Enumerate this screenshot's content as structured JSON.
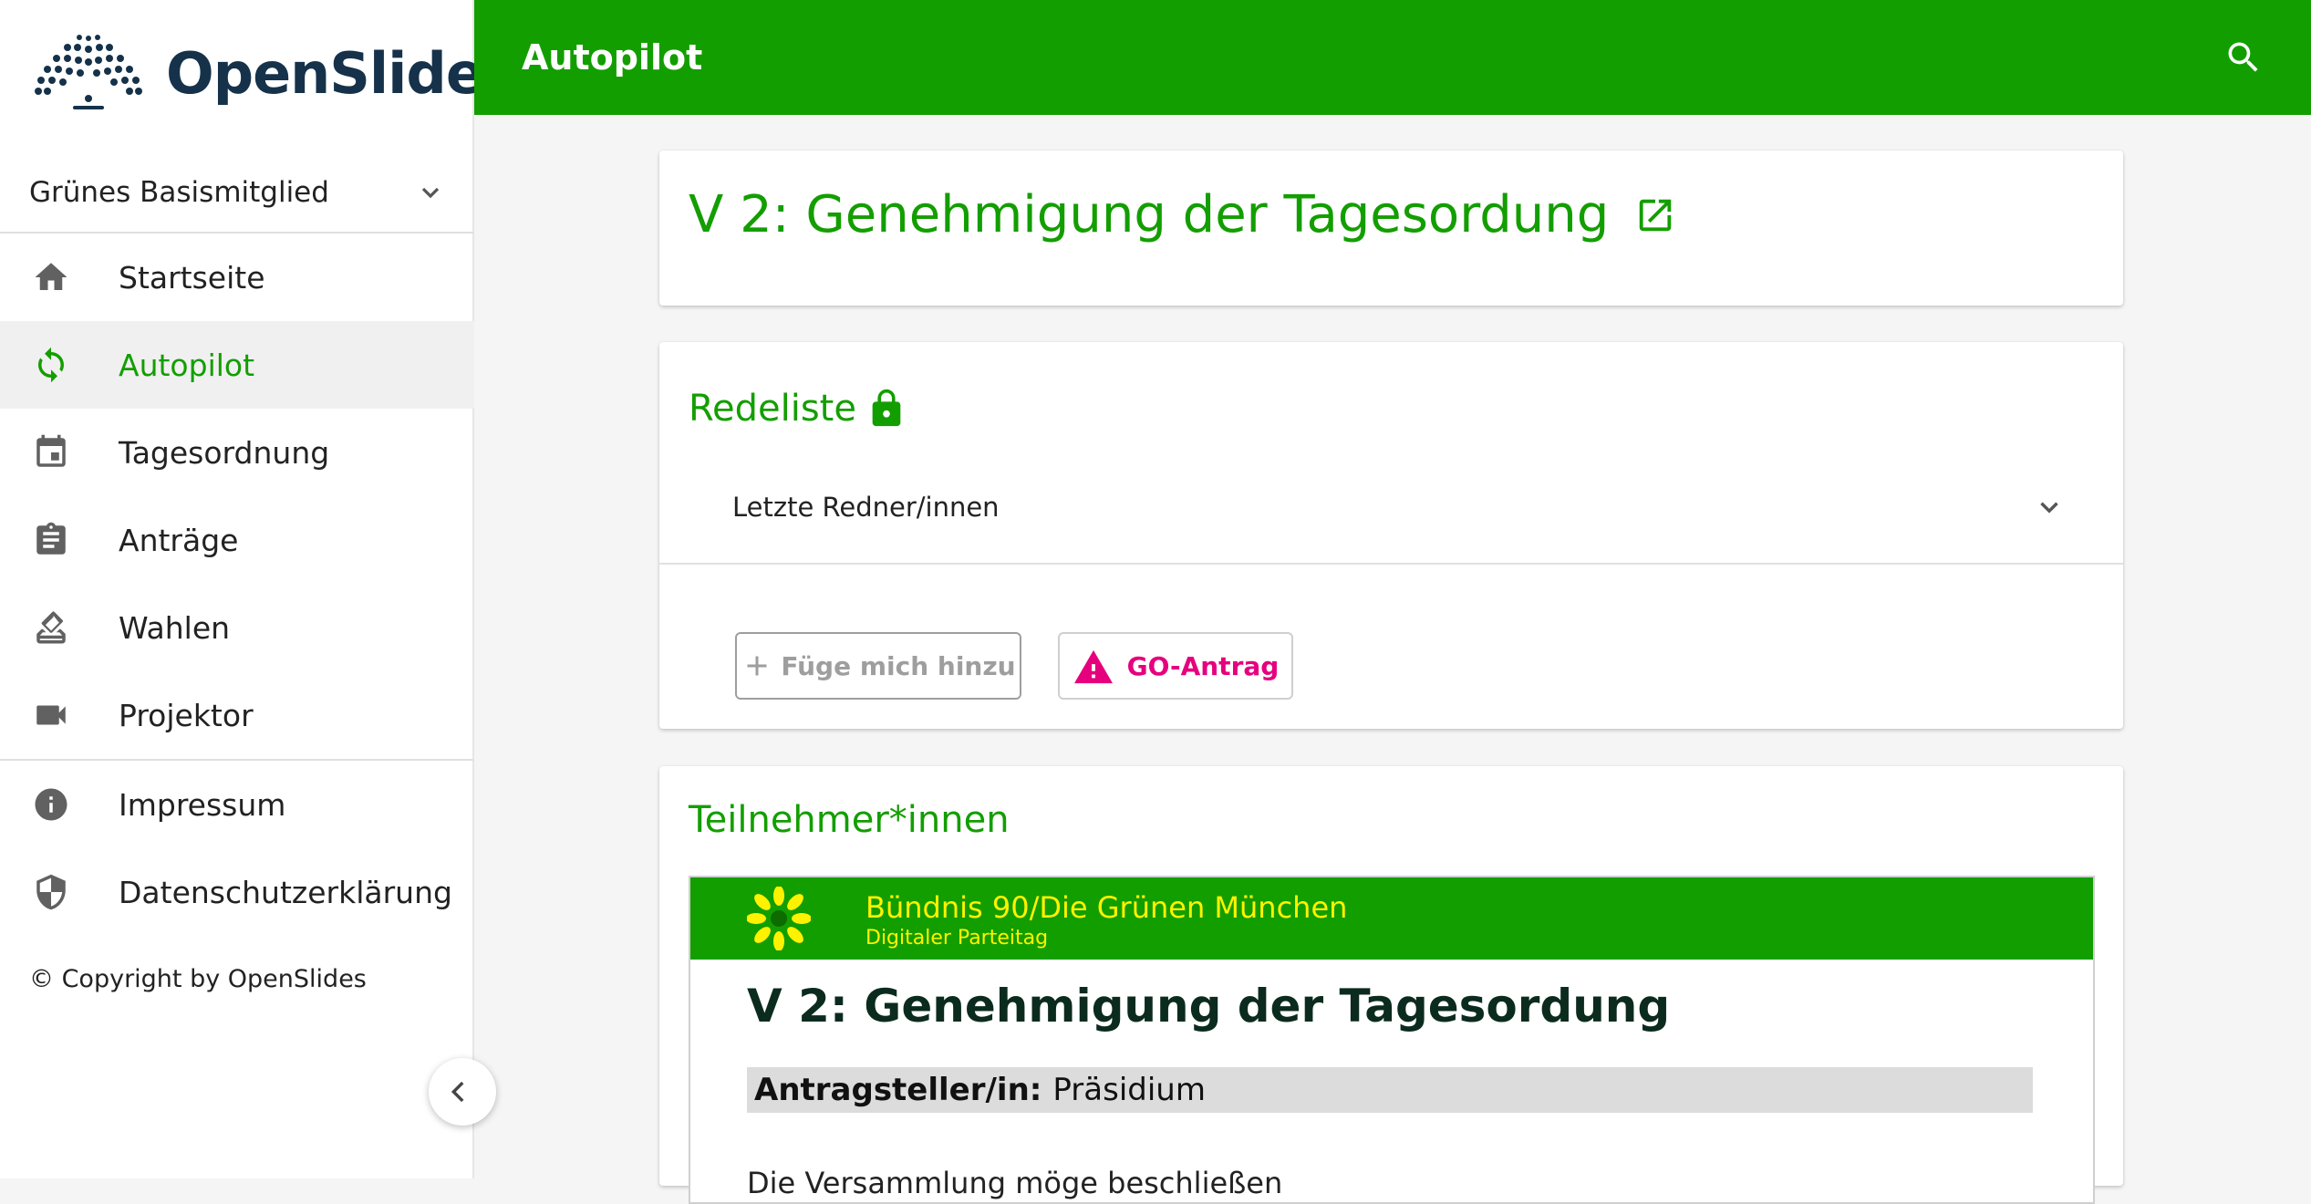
{
  "app": {
    "name": "OpenSlides",
    "accent_color": "#139e00",
    "warn_color": "#e6007e"
  },
  "user": {
    "name": "Grünes Basismitglied"
  },
  "sidebar": {
    "items": [
      {
        "label": "Startseite",
        "icon": "home-icon"
      },
      {
        "label": "Autopilot",
        "icon": "autopilot-sync-icon",
        "active": true
      },
      {
        "label": "Tagesordnung",
        "icon": "calendar-icon"
      },
      {
        "label": "Anträge",
        "icon": "clipboard-icon"
      },
      {
        "label": "Wahlen",
        "icon": "ballot-box-icon"
      },
      {
        "label": "Projektor",
        "icon": "videocam-icon"
      }
    ],
    "info_items": [
      {
        "label": "Impressum",
        "icon": "info-icon"
      },
      {
        "label": "Datenschutzerklärung",
        "icon": "shield-icon"
      }
    ],
    "copyright": "© Copyright by OpenSlides"
  },
  "toolbar": {
    "title": "Autopilot"
  },
  "agenda_item": {
    "title": "V 2: Genehmigung der Tagesordung"
  },
  "speakers": {
    "heading": "Redeliste",
    "last_speakers_label": "Letzte Redner/innen",
    "add_me_label": "Füge mich hinzu",
    "point_of_order_label": "GO-Antrag"
  },
  "participants": {
    "heading": "Teilnehmer*innen"
  },
  "projector": {
    "org_name": "Bündnis 90/Die Grünen München",
    "event_name": "Digitaler Parteitag",
    "slide_title": "V 2: Genehmigung der Tagesordung",
    "submitter_label": "Antragsteller/in:",
    "submitter_value": "Präsidium",
    "text_fragment": "Die Versammlung möge beschließen"
  }
}
